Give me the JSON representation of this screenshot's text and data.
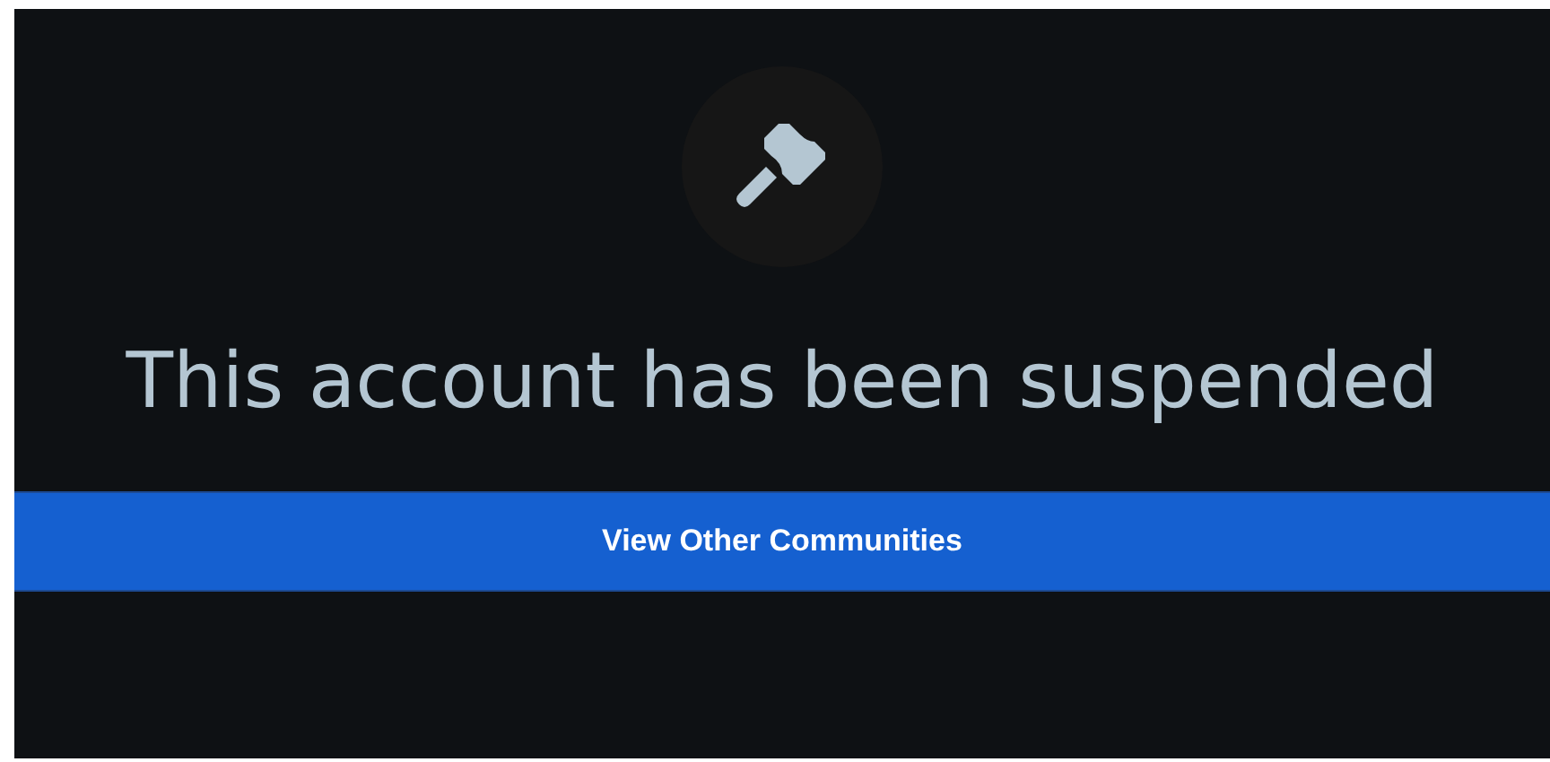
{
  "heading": "This account has been suspended",
  "button": {
    "label": "View Other Communities"
  }
}
